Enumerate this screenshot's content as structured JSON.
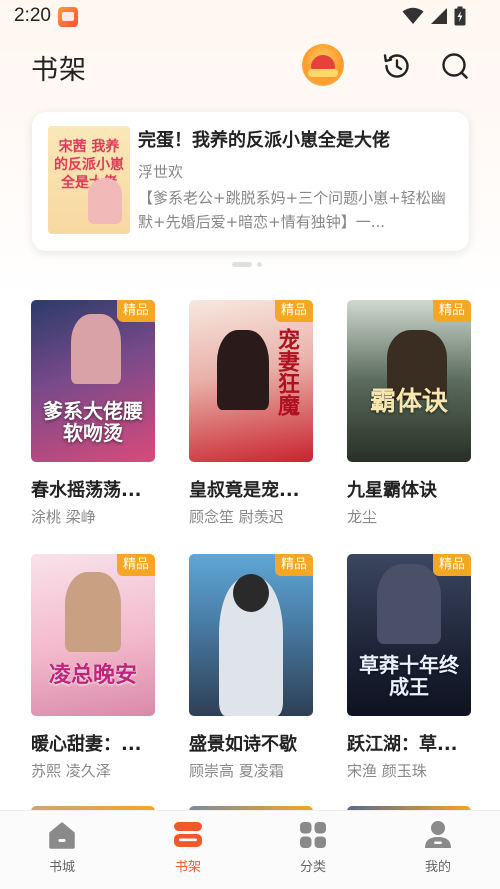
{
  "status_bar": {
    "time": "2:20"
  },
  "header": {
    "title": "书架"
  },
  "featured": {
    "cover_text": "宋茜 我养的反派小崽全是大佬",
    "title": "完蛋！我养的反派小崽全是大佬",
    "author": "浮世欢",
    "description": "【爹系老公+跳脱系妈+三个问题小崽+轻松幽默+先婚后爱+暗恋+情有独钟】一..."
  },
  "books": [
    {
      "title": "春水摇荡荡...",
      "author": "涂桃  梁峥",
      "tag": "精品",
      "cover_text": "爹系大佬腰软吻烫"
    },
    {
      "title": "皇叔竟是宠...",
      "author": "顾念笙  尉羡迟",
      "tag": "精品",
      "cover_text": "宠妻狂魔"
    },
    {
      "title": "九星霸体诀",
      "author": "龙尘",
      "tag": "精品",
      "cover_text": "霸体诀"
    },
    {
      "title": "暖心甜妻：...",
      "author": "苏熙  凌久泽",
      "tag": "精品",
      "cover_text": "凌总晚安"
    },
    {
      "title": "盛景如诗不歇",
      "author": "顾崇高 夏凌霜",
      "tag": "精品",
      "cover_text": ""
    },
    {
      "title": "跃江湖：草...",
      "author": "宋渔  颜玉珠",
      "tag": "精品",
      "cover_text": "草莽十年终成王"
    }
  ],
  "bottom_nav": [
    {
      "label": "书城",
      "icon": "home-icon",
      "active": false
    },
    {
      "label": "书架",
      "icon": "bookshelf-icon",
      "active": true
    },
    {
      "label": "分类",
      "icon": "category-icon",
      "active": false
    },
    {
      "label": "我的",
      "icon": "profile-icon",
      "active": false
    }
  ],
  "colors": {
    "accent": "#f2592a",
    "tag": "#f5a623",
    "muted": "#888888"
  }
}
